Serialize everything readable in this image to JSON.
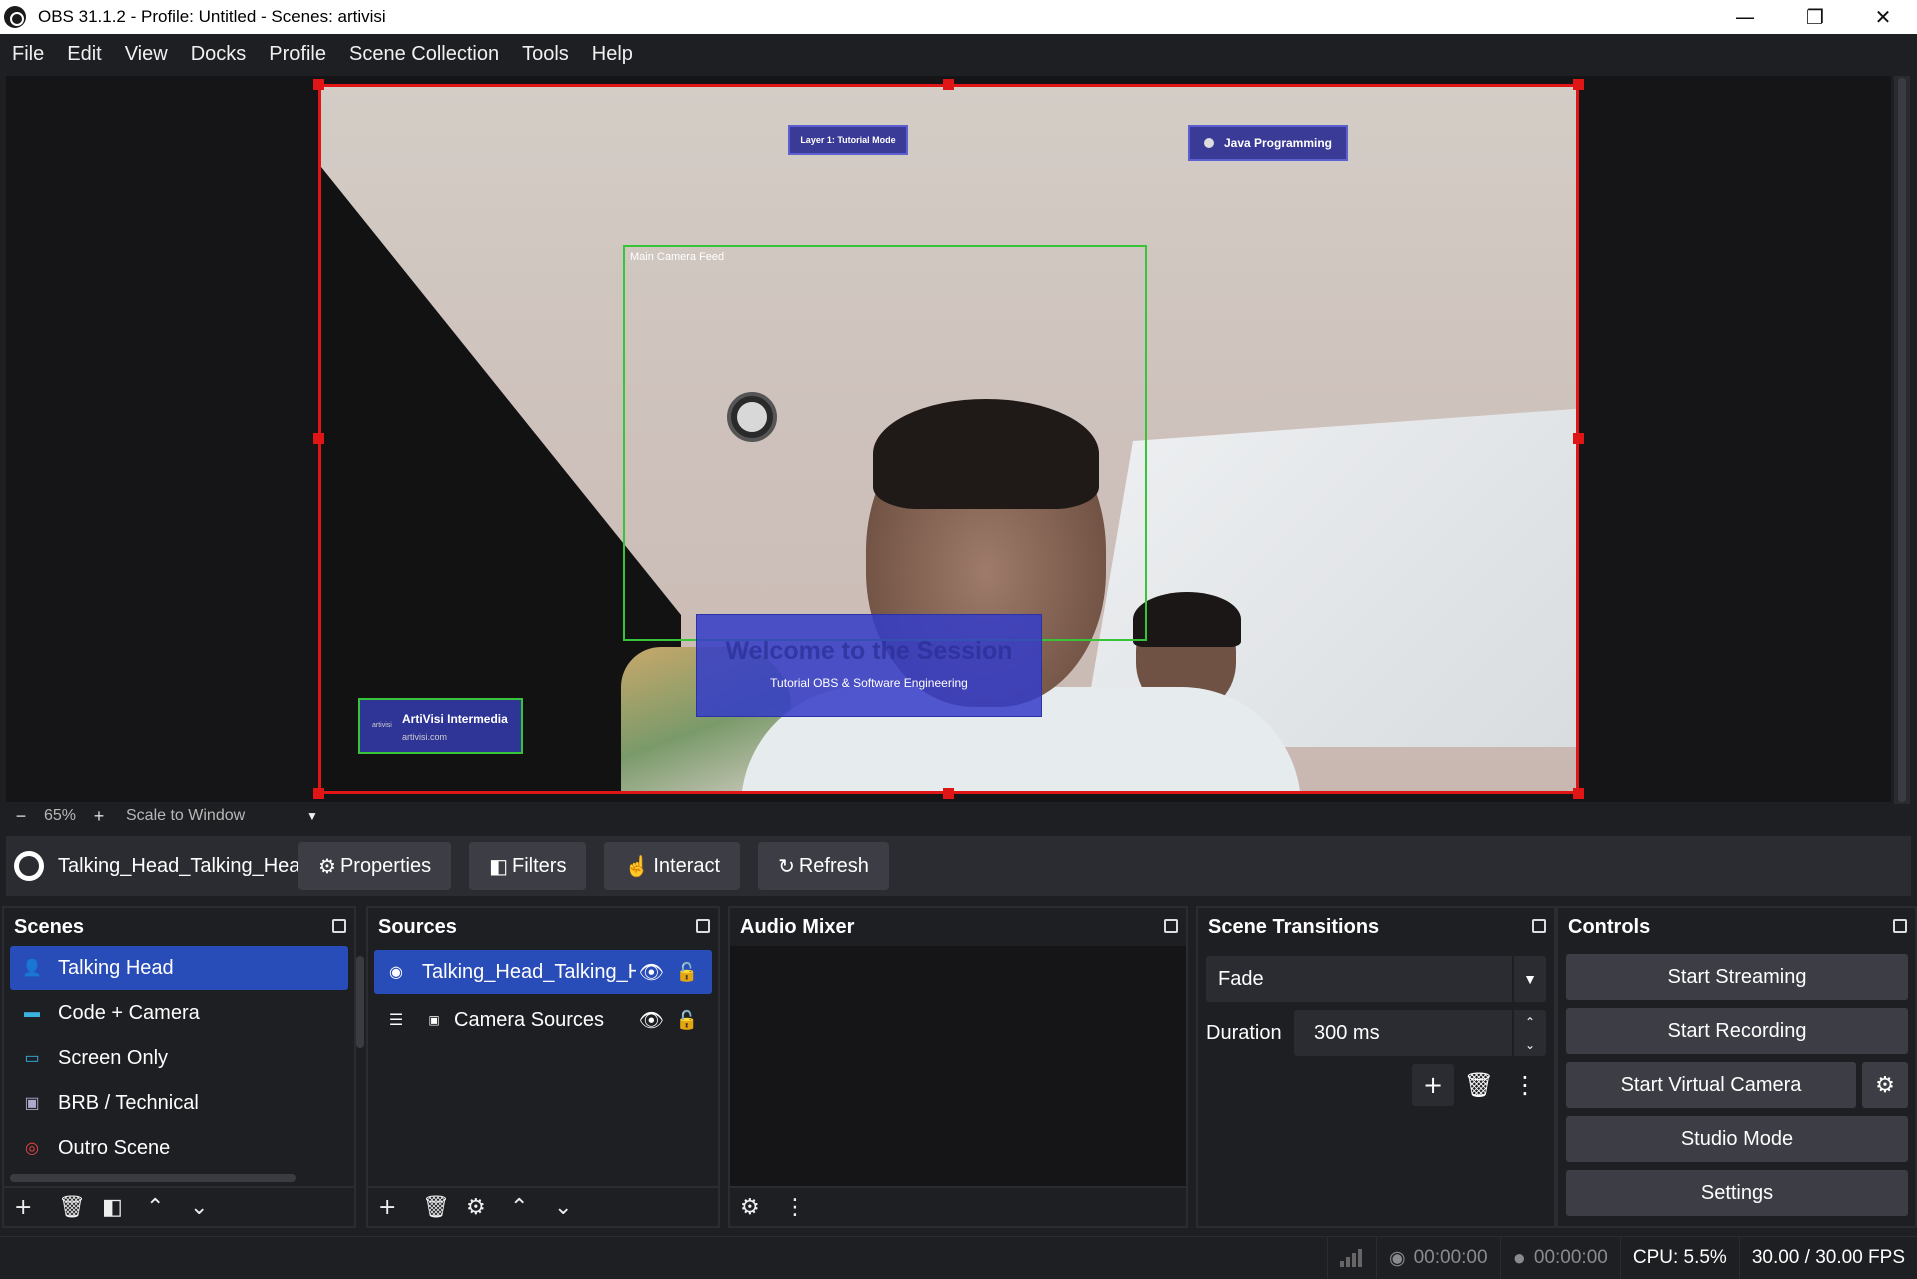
{
  "window": {
    "title": "OBS 31.1.2 - Profile: Untitled - Scenes: artivisi",
    "minimize_glyph": "—",
    "maximize_glyph": "❐",
    "close_glyph": "✕"
  },
  "menu": {
    "items": [
      "File",
      "Edit",
      "View",
      "Docks",
      "Profile",
      "Scene Collection",
      "Tools",
      "Help"
    ]
  },
  "preview": {
    "overlays": {
      "layer_badge": "Layer 1: Tutorial Mode",
      "java_badge": "Java Programming",
      "camera_feed_label": "Main Camera Feed",
      "welcome_title": "Welcome to the Session",
      "welcome_subtitle": "Tutorial OBS & Software Engineering",
      "brand_logo": "artivisi",
      "brand_name": "ArtiVisi Intermedia",
      "brand_url": "artivisi.com"
    },
    "zoom": {
      "minus": "−",
      "value": "65%",
      "plus": "+",
      "scale_mode": "Scale to Window"
    }
  },
  "context_bar": {
    "source_name": "Talking_Head_Talking_Head",
    "properties_label": "Properties",
    "filters_label": "Filters",
    "interact_label": "Interact",
    "refresh_label": "Refresh"
  },
  "scenes": {
    "title": "Scenes",
    "items": [
      {
        "label": "Talking Head",
        "icon": "person-icon",
        "selected": true
      },
      {
        "label": "Code + Camera",
        "icon": "monitor-icon",
        "selected": false
      },
      {
        "label": "Screen Only",
        "icon": "desktop-icon",
        "selected": false
      },
      {
        "label": "BRB / Technical",
        "icon": "tv-icon",
        "selected": false
      },
      {
        "label": "Outro Scene",
        "icon": "target-icon",
        "selected": false
      }
    ]
  },
  "sources": {
    "title": "Sources",
    "items": [
      {
        "label": "Talking_Head_Talking_Head",
        "icon": "browser-source-icon",
        "selected": true
      },
      {
        "label": "Camera Sources",
        "icon": "group-icon",
        "selected": false
      }
    ]
  },
  "audio_mixer": {
    "title": "Audio Mixer"
  },
  "transitions": {
    "title": "Scene Transitions",
    "selected": "Fade",
    "duration_label": "Duration",
    "duration_value": "300 ms"
  },
  "controls": {
    "title": "Controls",
    "start_streaming": "Start Streaming",
    "start_recording": "Start Recording",
    "start_virtual_camera": "Start Virtual Camera",
    "studio_mode": "Studio Mode",
    "settings": "Settings"
  },
  "status": {
    "stream_time": "00:00:00",
    "record_time": "00:00:00",
    "cpu": "CPU: 5.5%",
    "fps": "30.00 / 30.00 FPS"
  },
  "colors": {
    "accent_blue": "#284cb8",
    "selection_red": "#e01616",
    "source_green": "#38c438",
    "panel_bg": "#1e1f23",
    "button_bg": "#3c3d45"
  }
}
